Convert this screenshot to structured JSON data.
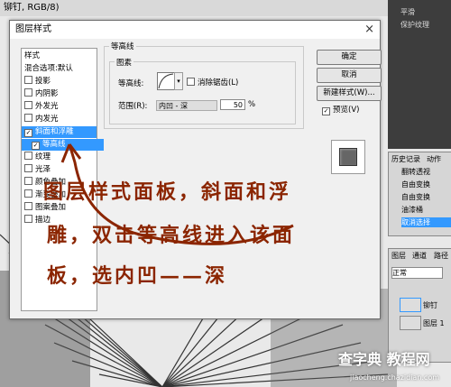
{
  "document": {
    "title": "铆钉, RGB/8)"
  },
  "dialog": {
    "title": "图层样式",
    "close_glyph": "×",
    "style_list": [
      {
        "label": "样式",
        "checkbox": false,
        "checked": false,
        "selected": false
      },
      {
        "label": "混合选项:默认",
        "checkbox": false,
        "checked": false,
        "selected": false
      },
      {
        "label": "投影",
        "checkbox": true,
        "checked": false,
        "selected": false
      },
      {
        "label": "内阴影",
        "checkbox": true,
        "checked": false,
        "selected": false
      },
      {
        "label": "外发光",
        "checkbox": true,
        "checked": false,
        "selected": false
      },
      {
        "label": "内发光",
        "checkbox": true,
        "checked": false,
        "selected": false
      },
      {
        "label": "斜面和浮雕",
        "checkbox": true,
        "checked": true,
        "selected": true
      },
      {
        "label": "等高线",
        "checkbox": true,
        "checked": true,
        "selected": true
      },
      {
        "label": "纹理",
        "checkbox": true,
        "checked": false,
        "selected": false
      },
      {
        "label": "光泽",
        "checkbox": true,
        "checked": false,
        "selected": false
      },
      {
        "label": "颜色叠加",
        "checkbox": true,
        "checked": false,
        "selected": false
      },
      {
        "label": "渐变叠加",
        "checkbox": true,
        "checked": false,
        "selected": false
      },
      {
        "label": "图案叠加",
        "checkbox": true,
        "checked": false,
        "selected": false
      },
      {
        "label": "描边",
        "checkbox": true,
        "checked": false,
        "selected": false
      }
    ],
    "section_title": "等高线",
    "group_title": "图素",
    "contour_label": "等高线:",
    "antialias_label": "消除锯齿(L)",
    "range_label": "范围(R):",
    "range_tooltip": "内凹 - 深",
    "range_value": "50",
    "range_unit": "%",
    "buttons": {
      "ok": "确定",
      "cancel": "取消",
      "new_style": "新建样式(W)...",
      "preview": "预览(V)"
    },
    "preview_checked": true
  },
  "right_panel": {
    "top_items": [
      "平滑",
      "保护纹理"
    ],
    "history_tabs": [
      "历史记录",
      "动作"
    ],
    "history_items": [
      "翻转透视",
      "自由变换",
      "自由变换",
      "油漆桶",
      "取消选择"
    ],
    "layers_tabs": [
      "图层",
      "通道",
      "路径"
    ],
    "blend_mode": "正常",
    "layers": [
      "铆钉",
      "图层 1"
    ]
  },
  "annotation": {
    "line1": "图层样式面板，斜面和浮",
    "line2": "雕，双击等高线进入该面",
    "line3": "板，选内凹——深"
  },
  "watermark": {
    "text": "查字典 教程网",
    "url": "jiaocheng.chazidian.com"
  },
  "colors": {
    "selection": "#3399ff",
    "handwriting": "#8b2500",
    "dialog_bg": "#f0f0f0"
  }
}
